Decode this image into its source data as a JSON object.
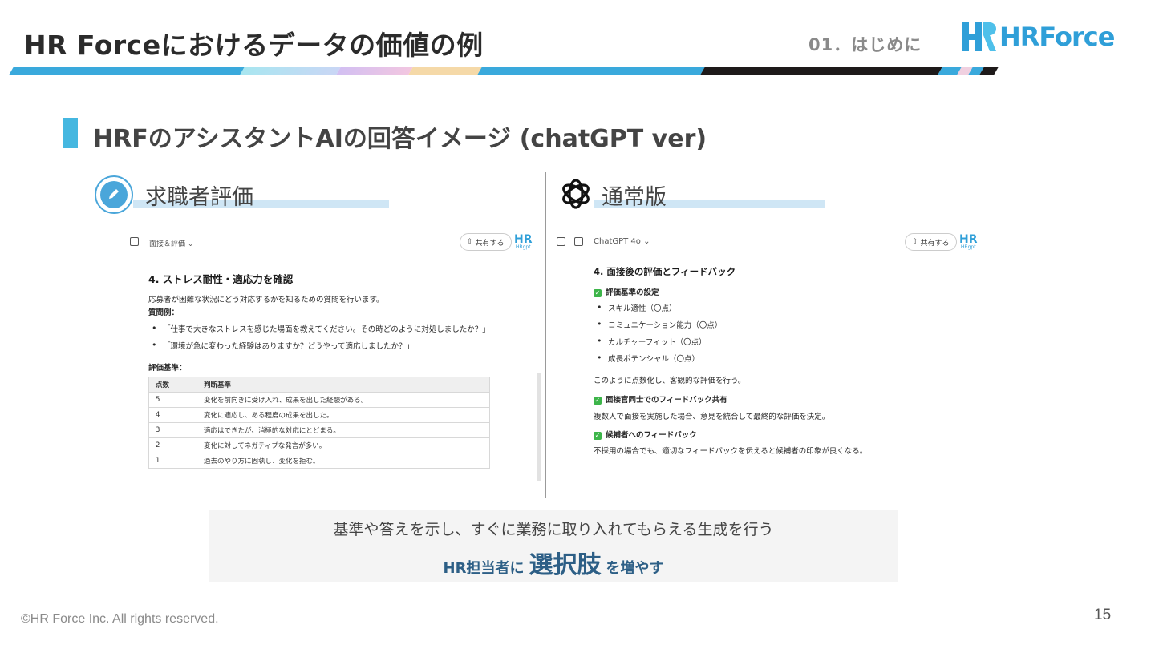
{
  "header": {
    "title": "HR Forceにおけるデータの価値の例",
    "section": "01．はじめに",
    "logo_text": "HRForce"
  },
  "colors": {
    "accent": "#45b7e0",
    "brand": "#2f9fd8",
    "band": [
      "#3aa9dc",
      "#a8e6f0",
      "#c9b8f0",
      "#f5d6a8",
      "#3aa9dc",
      "#1e1a1a",
      "#3aa9dc"
    ],
    "check": "#3db54a"
  },
  "subheading": "HRFのアシスタントAIの回答イメージ (chatGPT ver)",
  "left": {
    "label": "求職者評価",
    "icon": "pencil-circle-icon",
    "shot": {
      "breadcrumb": "面接＆評価 ⌄",
      "share": "共有する",
      "mini_logo": "HR",
      "mini_logo_sub": "HRgpt",
      "heading": "4. ストレス耐性・適応力を確認",
      "intro": "応募者が困難な状況にどう対応するかを知るための質問を行います。",
      "q_label": "質問例：",
      "questions": [
        "「仕事で大きなストレスを感じた場面を教えてください。その時どのように対処しましたか？」",
        "「環境が急に変わった経験はありますか？どうやって適応しましたか？」"
      ],
      "criteria_label": "評価基準：",
      "table": {
        "headers": [
          "点数",
          "判断基準"
        ],
        "rows": [
          [
            "5",
            "変化を前向きに受け入れ、成果を出した経験がある。"
          ],
          [
            "4",
            "変化に適応し、ある程度の成果を出した。"
          ],
          [
            "3",
            "適応はできたが、消極的な対応にとどまる。"
          ],
          [
            "2",
            "変化に対してネガティブな発言が多い。"
          ],
          [
            "1",
            "過去のやり方に固執し、変化を拒む。"
          ]
        ]
      }
    }
  },
  "right": {
    "label": "通常版",
    "icon": "openai-logo-icon",
    "shot": {
      "model": "ChatGPT 4o ⌄",
      "share": "共有する",
      "mini_logo": "HR",
      "mini_logo_sub": "HRgpt",
      "heading": "4. 面接後の評価とフィードバック",
      "s1_title": "評価基準の設定",
      "s1_items": [
        "スキル適性（〇点）",
        "コミュニケーション能力（〇点）",
        "カルチャーフィット（〇点）",
        "成長ポテンシャル（〇点）"
      ],
      "s1_note": "このように点数化し、客観的な評価を行う。",
      "s2_title": "面接官同士でのフィードバック共有",
      "s2_text": "複数人で面接を実施した場合、意見を統合して最終的な評価を決定。",
      "s3_title": "候補者へのフィードバック",
      "s3_text": "不採用の場合でも、適切なフィードバックを伝えると候補者の印象が良くなる。"
    }
  },
  "summary": {
    "line": "基準や答えを示し、すぐに業務に取り入れてもらえる生成を行う",
    "pre": "HR担当者に",
    "emphasis": "選択肢",
    "post": "を増やす"
  },
  "footer": {
    "copyright": "©HR Force Inc. All rights reserved.",
    "page": "15"
  }
}
